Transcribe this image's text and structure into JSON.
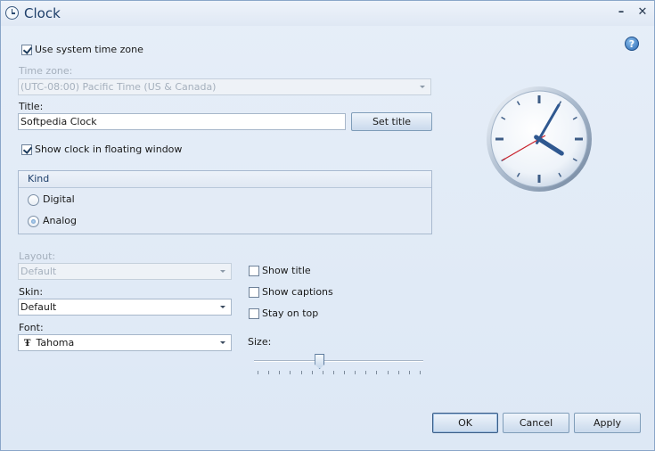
{
  "window": {
    "title": "Clock",
    "minimize_glyph": "–",
    "close_glyph": "✕"
  },
  "help": {
    "glyph": "?"
  },
  "timezone": {
    "use_system_label": "Use system time zone",
    "use_system_checked": true,
    "label": "Time zone:",
    "value": "(UTC-08:00) Pacific Time (US & Canada)"
  },
  "title_field": {
    "label": "Title:",
    "value": "Softpedia Clock",
    "set_button": "Set title"
  },
  "floating": {
    "label": "Show clock in floating window",
    "checked": true
  },
  "kind": {
    "header": "Kind",
    "options": [
      {
        "label": "Digital",
        "selected": false
      },
      {
        "label": "Analog",
        "selected": true
      }
    ]
  },
  "layout": {
    "label": "Layout:",
    "value": "Default"
  },
  "skin": {
    "label": "Skin:",
    "value": "Default"
  },
  "font": {
    "label": "Font:",
    "value": "Tahoma",
    "glyph": "Ŧ"
  },
  "options": {
    "show_title": "Show title",
    "show_captions": "Show captions",
    "stay_on_top": "Stay on top"
  },
  "size": {
    "label": "Size:",
    "level": 0.38
  },
  "buttons": {
    "ok": "OK",
    "cancel": "Cancel",
    "apply": "Apply"
  },
  "colors": {
    "accent": "#1e3f6a",
    "second_hand": "#c8202a",
    "hands": "#2f5890"
  },
  "clock": {
    "hour": 4.0,
    "minute": 5,
    "second": 40
  }
}
